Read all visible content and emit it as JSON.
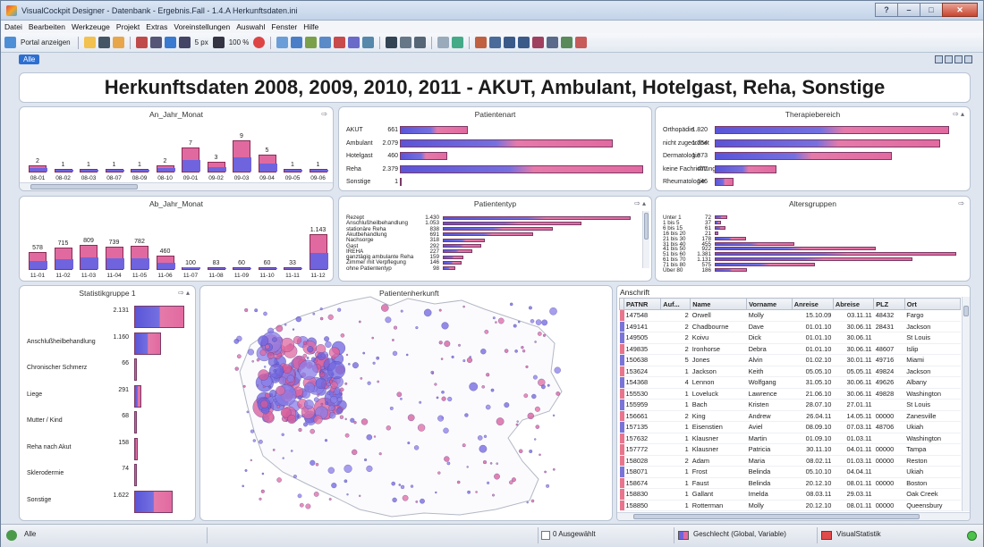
{
  "window": {
    "title": "VisualCockpit Designer - Datenbank - Ergebnis.Fall - 1.4.A Herkunftsdaten.ini"
  },
  "menu": [
    "Datei",
    "Bearbeiten",
    "Werkzeuge",
    "Projekt",
    "Extras",
    "Voreinstellungen",
    "Auswahl",
    "Fenster",
    "Hilfe"
  ],
  "toolbar": {
    "portal_label": "Portal anzeigen",
    "size_label": "5 px",
    "zoom_label": "100 %"
  },
  "tab": {
    "label": "Alle"
  },
  "main_title": "Herkunftsdaten 2008, 2009, 2010, 2011 - AKUT, Ambulant, Hotelgast, Reha, Sonstige",
  "colors": {
    "series_a": "#6f64dd",
    "series_b": "#e06aa0"
  },
  "panels": {
    "an_jahr_monat": {
      "title": "An_Jahr_Monat"
    },
    "patientenart": {
      "title": "Patientenart"
    },
    "therapiebereich": {
      "title": "Therapiebereich"
    },
    "ab_jahr_monat": {
      "title": "Ab_Jahr_Monat"
    },
    "patiententyp": {
      "title": "Patiententyp"
    },
    "altersgruppen": {
      "title": "Altersgruppen"
    },
    "statistikgruppe": {
      "title": "Statistikgruppe 1"
    },
    "patientenherkunft": {
      "title": "Patientenherkunft"
    },
    "anschrift": {
      "title": "Anschrift"
    }
  },
  "chart_data": [
    {
      "type": "bar",
      "title": "An_Jahr_Monat",
      "categories": [
        "08-01",
        "08-02",
        "08-03",
        "08-07",
        "08-09",
        "08-10",
        "09-01",
        "09-02",
        "09-03",
        "09-04",
        "09-05",
        "09-06"
      ],
      "values": [
        2,
        1,
        1,
        1,
        1,
        2,
        7,
        3,
        9,
        5,
        1,
        1
      ]
    },
    {
      "type": "bar",
      "title": "Ab_Jahr_Monat",
      "categories": [
        "11-01",
        "11-02",
        "11-03",
        "11-04",
        "11-05",
        "11-06",
        "11-07",
        "11-08",
        "11-09",
        "11-10",
        "11-11",
        "11-12"
      ],
      "values": [
        578,
        715,
        809,
        739,
        782,
        460,
        100,
        83,
        60,
        60,
        33,
        1143
      ],
      "labels": [
        "578",
        "715",
        "809",
        "739",
        "782",
        "460",
        "100",
        "83",
        "60",
        "60",
        "33",
        "1.143"
      ]
    },
    {
      "type": "bar",
      "title": "Patientenart",
      "categories": [
        "AKUT",
        "Ambulant",
        "Hotelgast",
        "Reha",
        "Sonstige"
      ],
      "values": [
        661,
        2079,
        460,
        2379,
        1
      ],
      "labels": [
        "661",
        "2.079",
        "460",
        "2.379",
        "1"
      ]
    },
    {
      "type": "bar",
      "title": "Therapiebereich",
      "categories": [
        "Orthopädie",
        "nicht zugeordnet",
        "Dermatologie",
        "keine Fachrichtung",
        "Rheumatologie"
      ],
      "values": [
        1820,
        1754,
        1373,
        477,
        146
      ],
      "labels": [
        "1.820",
        "1.754",
        "1.373",
        "477",
        "146"
      ]
    },
    {
      "type": "bar",
      "title": "Patiententyp",
      "categories": [
        "Rezept",
        "Anschlußheilbehandlung",
        "stationäre Reha",
        "Akutbehandlung",
        "Nachsorge",
        "Gast",
        "IREHA",
        "ganztägig ambulante Reha",
        "Zimmer mit Verpflegung",
        "ohne Patiententyp"
      ],
      "values": [
        1430,
        1053,
        838,
        691,
        318,
        292,
        227,
        159,
        146,
        98
      ],
      "labels": [
        "1.430",
        "1.053",
        "838",
        "691",
        "318",
        "292",
        "227",
        "159",
        "146",
        "98"
      ]
    },
    {
      "type": "bar",
      "title": "Altersgruppen",
      "categories": [
        "Unter 1",
        "1 bis 5",
        "6 bis 15",
        "16 bis 20",
        "21 bis 30",
        "31 bis 40",
        "41 bis 50",
        "51 bis 60",
        "61 bis 70",
        "71 bis 80",
        "Über 80"
      ],
      "values": [
        72,
        37,
        61,
        21,
        178,
        455,
        922,
        1381,
        1131,
        575,
        186
      ],
      "labels": [
        "72",
        "37",
        "61",
        "21",
        "178",
        "455",
        "922",
        "1.381",
        "1.131",
        "575",
        "186"
      ]
    },
    {
      "type": "bar",
      "title": "Statistikgruppe 1",
      "categories": [
        "",
        "Anschlußheilbehandlung",
        "Chronischer Schmerz",
        "Liege",
        "Mutter / Kind",
        "Reha nach Akut",
        "Sklerodermie",
        "Sonstige"
      ],
      "values": [
        2131,
        1160,
        66,
        291,
        68,
        158,
        74,
        1622
      ],
      "labels": [
        "2.131",
        "1.160",
        "66",
        "291",
        "68",
        "158",
        "74",
        "1.622"
      ]
    }
  ],
  "table": {
    "columns": [
      "PATNR",
      "Auf...",
      "Name",
      "Vorname",
      "Anreise",
      "Abreise",
      "PLZ",
      "Ort"
    ],
    "rows": [
      [
        "147548",
        "2",
        "Orwell",
        "Molly",
        "15.10.09",
        "03.11.11",
        "48432",
        "Fargo"
      ],
      [
        "149141",
        "2",
        "Chadbourne",
        "Dave",
        "01.01.10",
        "30.06.11",
        "28431",
        "Jackson"
      ],
      [
        "149505",
        "2",
        "Koivu",
        "Dick",
        "01.01.10",
        "30.06.11",
        "",
        "St Louis"
      ],
      [
        "149835",
        "2",
        "Ironhorse",
        "Debra",
        "01.01.10",
        "30.06.11",
        "48607",
        "Islip"
      ],
      [
        "150638",
        "5",
        "Jones",
        "Alvin",
        "01.02.10",
        "30.01.11",
        "49716",
        "Miami"
      ],
      [
        "153624",
        "1",
        "Jackson",
        "Keith",
        "05.05.10",
        "05.05.11",
        "49824",
        "Jackson"
      ],
      [
        "154368",
        "4",
        "Lennon",
        "Wolfgang",
        "31.05.10",
        "30.06.11",
        "49626",
        "Albany"
      ],
      [
        "155530",
        "1",
        "Loveluck",
        "Lawrence",
        "21.06.10",
        "30.06.11",
        "49828",
        "Washington"
      ],
      [
        "155959",
        "1",
        "Bach",
        "Kristen",
        "28.07.10",
        "27.01.11",
        "",
        "St Louis"
      ],
      [
        "156661",
        "2",
        "King",
        "Andrew",
        "26.04.11",
        "14.05.11",
        "00000",
        "Zanesville"
      ],
      [
        "157135",
        "1",
        "Eisenstien",
        "Aviel",
        "08.09.10",
        "07.03.11",
        "48706",
        "Ukiah"
      ],
      [
        "157632",
        "1",
        "Klausner",
        "Martin",
        "01.09.10",
        "01.03.11",
        "",
        "Washington"
      ],
      [
        "157772",
        "1",
        "Klausner",
        "Patricia",
        "30.11.10",
        "04.01.11",
        "00000",
        "Tampa"
      ],
      [
        "158028",
        "2",
        "Adam",
        "Maria",
        "08.02.11",
        "01.03.11",
        "00000",
        "Reston"
      ],
      [
        "158071",
        "1",
        "Frost",
        "Belinda",
        "05.10.10",
        "04.04.11",
        "",
        "Ukiah"
      ],
      [
        "158674",
        "1",
        "Faust",
        "Belinda",
        "20.12.10",
        "08.01.11",
        "00000",
        "Boston"
      ],
      [
        "158830",
        "1",
        "Gallant",
        "Imelda",
        "08.03.11",
        "29.03.11",
        "",
        "Oak Creek"
      ],
      [
        "158850",
        "1",
        "Rotterman",
        "Molly",
        "20.12.10",
        "08.01.11",
        "00000",
        "Queensbury"
      ],
      [
        "158851",
        "1",
        "Quixote",
        "Dmitry",
        "20.12.10",
        "08.01.11",
        "00000",
        "Larchmont"
      ],
      [
        "159160",
        "4",
        "Houseman",
        "William",
        "01.01.11",
        "30.12.11",
        "48607",
        "Reston"
      ]
    ],
    "row_colors": [
      "#e8758d",
      "#7a74d8",
      "#7a74d8",
      "#e8758d",
      "#7a74d8",
      "#e8758d",
      "#7a74d8",
      "#e8758d",
      "#7a74d8",
      "#e8758d",
      "#7a74d8",
      "#e8758d",
      "#e8758d",
      "#e8758d",
      "#7a74d8",
      "#e8758d",
      "#e8758d",
      "#e8758d",
      "#e8758d",
      "#7a74d8"
    ]
  },
  "status": {
    "left": "Alle",
    "selected": "0 Ausgewählt",
    "legend": "Geschlecht (Global, Variable)",
    "app": "VisualStatistik"
  }
}
